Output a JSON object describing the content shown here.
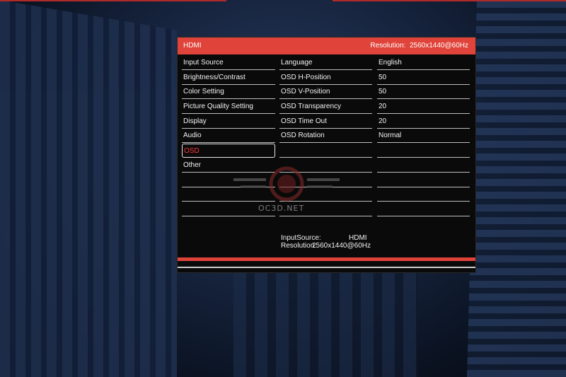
{
  "header": {
    "input": "HDMI",
    "resolution_label": "Resolution:",
    "resolution_value": "2560x1440@60Hz"
  },
  "menu": [
    {
      "label": "Input Source"
    },
    {
      "label": "Brightness/Contrast"
    },
    {
      "label": "Color Setting"
    },
    {
      "label": "Picture Quality Setting"
    },
    {
      "label": "Display"
    },
    {
      "label": "Audio"
    },
    {
      "label": "OSD",
      "selected": true
    },
    {
      "label": "Other"
    },
    {
      "label": ""
    },
    {
      "label": ""
    },
    {
      "label": ""
    }
  ],
  "settings": [
    {
      "label": "Language",
      "value": "English"
    },
    {
      "label": "OSD H-Position",
      "value": "50"
    },
    {
      "label": "OSD V-Position",
      "value": "50"
    },
    {
      "label": "OSD Transparency",
      "value": "20"
    },
    {
      "label": "OSD Time Out",
      "value": "20"
    },
    {
      "label": "OSD Rotation",
      "value": "Normal"
    }
  ],
  "info": {
    "input_label": "InputSource:",
    "input_value": "HDMI",
    "resolution_label": "Resolution:",
    "resolution_value": "2560x1440@60Hz"
  },
  "watermark": "OC3D.NET",
  "colors": {
    "accent": "#e0433a",
    "selected_text": "#ff3a3a"
  }
}
